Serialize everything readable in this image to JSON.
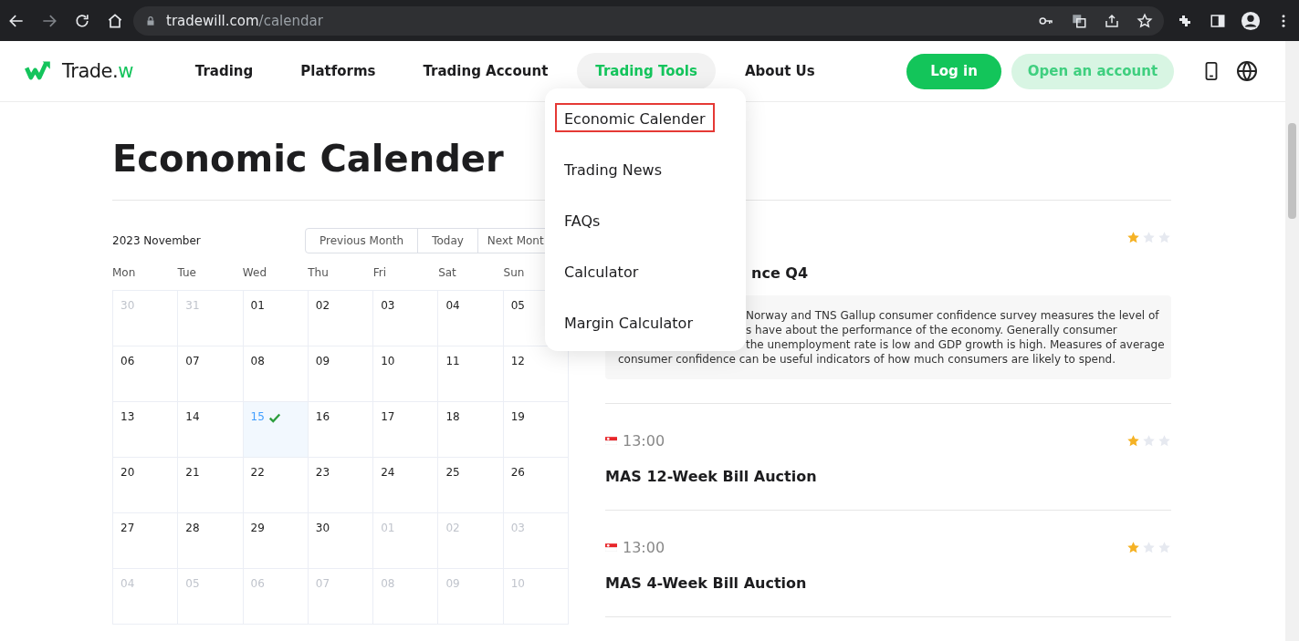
{
  "browser": {
    "url_host": "tradewill.com",
    "url_path": "/calendar"
  },
  "header": {
    "logo": {
      "text": "Trade.",
      "accent": "w"
    },
    "nav": [
      {
        "label": "Trading",
        "selected": false
      },
      {
        "label": "Platforms",
        "selected": false
      },
      {
        "label": "Trading Account",
        "selected": false
      },
      {
        "label": "Trading Tools",
        "selected": true
      },
      {
        "label": "About Us",
        "selected": false
      }
    ],
    "login": "Log in",
    "open_account": "Open an account"
  },
  "dropdown": {
    "items": [
      {
        "label": "Economic Calender",
        "selected": true
      },
      {
        "label": "Trading News",
        "selected": false
      },
      {
        "label": "FAQs",
        "selected": false
      },
      {
        "label": "Calculator",
        "selected": false
      },
      {
        "label": "Margin Calculator",
        "selected": false
      }
    ]
  },
  "page_title": "Economic Calender",
  "calendar": {
    "month": "2023 November",
    "buttons": [
      "Previous Month",
      "Today",
      "Next Mont"
    ],
    "weekdays": [
      "Mon",
      "Tue",
      "Wed",
      "Thu",
      "Fri",
      "Sat",
      "Sun"
    ],
    "weeks": [
      [
        {
          "day": "30",
          "other_month": true,
          "selected": false
        },
        {
          "day": "31",
          "other_month": true,
          "selected": false
        },
        {
          "day": "01",
          "other_month": false,
          "selected": false
        },
        {
          "day": "02",
          "other_month": false,
          "selected": false
        },
        {
          "day": "03",
          "other_month": false,
          "selected": false
        },
        {
          "day": "04",
          "other_month": false,
          "selected": false
        },
        {
          "day": "05",
          "other_month": false,
          "selected": false
        }
      ],
      [
        {
          "day": "06",
          "other_month": false,
          "selected": false
        },
        {
          "day": "07",
          "other_month": false,
          "selected": false
        },
        {
          "day": "08",
          "other_month": false,
          "selected": false
        },
        {
          "day": "09",
          "other_month": false,
          "selected": false
        },
        {
          "day": "10",
          "other_month": false,
          "selected": false
        },
        {
          "day": "11",
          "other_month": false,
          "selected": false
        },
        {
          "day": "12",
          "other_month": false,
          "selected": false
        }
      ],
      [
        {
          "day": "13",
          "other_month": false,
          "selected": false
        },
        {
          "day": "14",
          "other_month": false,
          "selected": false
        },
        {
          "day": "15",
          "other_month": false,
          "selected": true
        },
        {
          "day": "16",
          "other_month": false,
          "selected": false
        },
        {
          "day": "17",
          "other_month": false,
          "selected": false
        },
        {
          "day": "18",
          "other_month": false,
          "selected": false
        },
        {
          "day": "19",
          "other_month": false,
          "selected": false
        }
      ],
      [
        {
          "day": "20",
          "other_month": false,
          "selected": false
        },
        {
          "day": "21",
          "other_month": false,
          "selected": false
        },
        {
          "day": "22",
          "other_month": false,
          "selected": false
        },
        {
          "day": "23",
          "other_month": false,
          "selected": false
        },
        {
          "day": "24",
          "other_month": false,
          "selected": false
        },
        {
          "day": "25",
          "other_month": false,
          "selected": false
        },
        {
          "day": "26",
          "other_month": false,
          "selected": false
        }
      ],
      [
        {
          "day": "27",
          "other_month": false,
          "selected": false
        },
        {
          "day": "28",
          "other_month": false,
          "selected": false
        },
        {
          "day": "29",
          "other_month": false,
          "selected": false
        },
        {
          "day": "30",
          "other_month": false,
          "selected": false
        },
        {
          "day": "01",
          "other_month": true,
          "selected": false
        },
        {
          "day": "02",
          "other_month": true,
          "selected": false
        },
        {
          "day": "03",
          "other_month": true,
          "selected": false
        }
      ],
      [
        {
          "day": "04",
          "other_month": true,
          "selected": false
        },
        {
          "day": "05",
          "other_month": true,
          "selected": false
        },
        {
          "day": "06",
          "other_month": true,
          "selected": false
        },
        {
          "day": "07",
          "other_month": true,
          "selected": false
        },
        {
          "day": "08",
          "other_month": true,
          "selected": false
        },
        {
          "day": "09",
          "other_month": true,
          "selected": false
        },
        {
          "day": "10",
          "other_month": true,
          "selected": false
        }
      ]
    ]
  },
  "events": [
    {
      "covered": true,
      "stars": 1,
      "title": "nce Q4",
      "description_lines": [
        {
          "text": "Norway and TNS Gallup consumer confidence survey measures the level of",
          "covered": true
        },
        {
          "text": "s have about the performance of the economy. Generally consumer",
          "covered": true
        },
        {
          "text": "the unemployment rate is low and GDP growth is high. Measures of average",
          "covered": true
        },
        {
          "text": "consumer confidence can be useful indicators of how much consumers are likely to spend.",
          "covered": false
        }
      ]
    },
    {
      "covered": false,
      "time": "13:00",
      "stars": 1,
      "title": "MAS 12-Week Bill Auction"
    },
    {
      "covered": false,
      "time": "13:00",
      "stars": 1,
      "title": "MAS 4-Week Bill Auction"
    }
  ]
}
